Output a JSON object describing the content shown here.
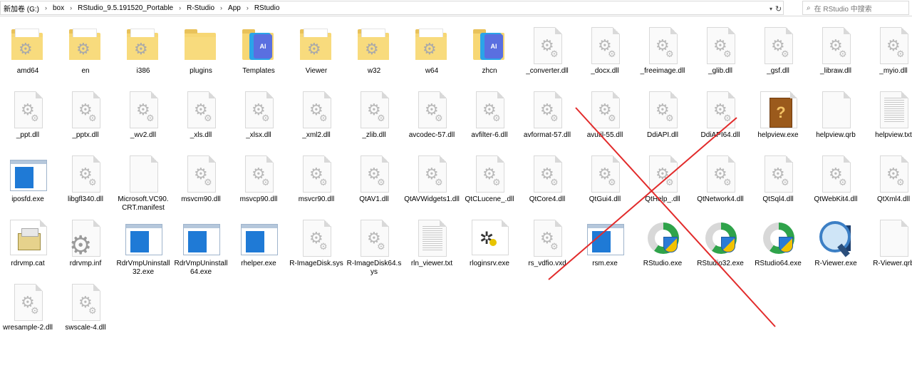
{
  "address_bar": {
    "crumbs": [
      "新加卷 (G:)",
      "box",
      "RStudio_9.5.191520_Portable",
      "R-Studio",
      "App",
      "RStudio"
    ]
  },
  "search": {
    "placeholder": "在 RStudio 中搜索"
  },
  "items": [
    {
      "label": "amd64",
      "icon": "folder-gear"
    },
    {
      "label": "en",
      "icon": "folder-gear"
    },
    {
      "label": "i386",
      "icon": "folder-gear"
    },
    {
      "label": "plugins",
      "icon": "folder"
    },
    {
      "label": "Templates",
      "icon": "templates-ai"
    },
    {
      "label": "Viewer",
      "icon": "folder-gear"
    },
    {
      "label": "w32",
      "icon": "folder-gear"
    },
    {
      "label": "w64",
      "icon": "folder-gear"
    },
    {
      "label": "zhcn",
      "icon": "folder-ai"
    },
    {
      "label": "_converter.dll",
      "icon": "dll"
    },
    {
      "label": "_docx.dll",
      "icon": "dll"
    },
    {
      "label": "_freeimage.dll",
      "icon": "dll"
    },
    {
      "label": "_glib.dll",
      "icon": "dll"
    },
    {
      "label": "_gsf.dll",
      "icon": "dll"
    },
    {
      "label": "_libraw.dll",
      "icon": "dll"
    },
    {
      "label": "_myio.dll",
      "icon": "dll"
    },
    {
      "label": "_ppt.dll",
      "icon": "dll"
    },
    {
      "label": "_pptx.dll",
      "icon": "dll"
    },
    {
      "label": "_wv2.dll",
      "icon": "dll"
    },
    {
      "label": "_xls.dll",
      "icon": "dll"
    },
    {
      "label": "_xlsx.dll",
      "icon": "dll"
    },
    {
      "label": "_xml2.dll",
      "icon": "dll"
    },
    {
      "label": "_zlib.dll",
      "icon": "dll"
    },
    {
      "label": "avcodec-57.dll",
      "icon": "dll"
    },
    {
      "label": "avfilter-6.dll",
      "icon": "dll"
    },
    {
      "label": "avformat-57.dll",
      "icon": "dll"
    },
    {
      "label": "avutil-55.dll",
      "icon": "dll"
    },
    {
      "label": "DdiAPI.dll",
      "icon": "dll"
    },
    {
      "label": "DdiAPI64.dll",
      "icon": "dll"
    },
    {
      "label": "helpview.exe",
      "icon": "help-book"
    },
    {
      "label": "helpview.qrb",
      "icon": "blank"
    },
    {
      "label": "helpview.txt",
      "icon": "text"
    },
    {
      "label": "iposfd.exe",
      "icon": "app-window"
    },
    {
      "label": "libgfl340.dll",
      "icon": "dll"
    },
    {
      "label": "Microsoft.VC90.CRT.manifest",
      "icon": "blank"
    },
    {
      "label": "msvcm90.dll",
      "icon": "dll"
    },
    {
      "label": "msvcp90.dll",
      "icon": "dll"
    },
    {
      "label": "msvcr90.dll",
      "icon": "dll"
    },
    {
      "label": "QtAV1.dll",
      "icon": "dll"
    },
    {
      "label": "QtAVWidgets1.dll",
      "icon": "dll"
    },
    {
      "label": "QtCLucene_.dll",
      "icon": "dll"
    },
    {
      "label": "QtCore4.dll",
      "icon": "dll"
    },
    {
      "label": "QtGui4.dll",
      "icon": "dll"
    },
    {
      "label": "QtHelp_.dll",
      "icon": "dll"
    },
    {
      "label": "QtNetwork4.dll",
      "icon": "dll"
    },
    {
      "label": "QtSql4.dll",
      "icon": "dll"
    },
    {
      "label": "QtWebKit4.dll",
      "icon": "dll"
    },
    {
      "label": "QtXml4.dll",
      "icon": "dll"
    },
    {
      "label": "rdrvmp.cat",
      "icon": "catalog"
    },
    {
      "label": "rdrvmp.inf",
      "icon": "inf-gear"
    },
    {
      "label": "RdrVmpUninstall32.exe",
      "icon": "app-window"
    },
    {
      "label": "RdrVmpUninstall64.exe",
      "icon": "app-window"
    },
    {
      "label": "rhelper.exe",
      "icon": "app-window"
    },
    {
      "label": "R-ImageDisk.sys",
      "icon": "dll"
    },
    {
      "label": "R-ImageDisk64.sys",
      "icon": "dll"
    },
    {
      "label": "rln_viewer.txt",
      "icon": "text"
    },
    {
      "label": "rloginsrv.exe",
      "icon": "bug"
    },
    {
      "label": "rs_vdfio.vxd",
      "icon": "dll"
    },
    {
      "label": "rsm.exe",
      "icon": "app-window"
    },
    {
      "label": "RStudio.exe",
      "icon": "rstudio"
    },
    {
      "label": "RStudio32.exe",
      "icon": "rstudio"
    },
    {
      "label": "RStudio64.exe",
      "icon": "rstudio"
    },
    {
      "label": "R-Viewer.exe",
      "icon": "magnifier"
    },
    {
      "label": "R-Viewer.qrb",
      "icon": "blank"
    },
    {
      "label": "wresample-2.dll",
      "icon": "dll"
    },
    {
      "label": "swscale-4.dll",
      "icon": "dll"
    }
  ]
}
